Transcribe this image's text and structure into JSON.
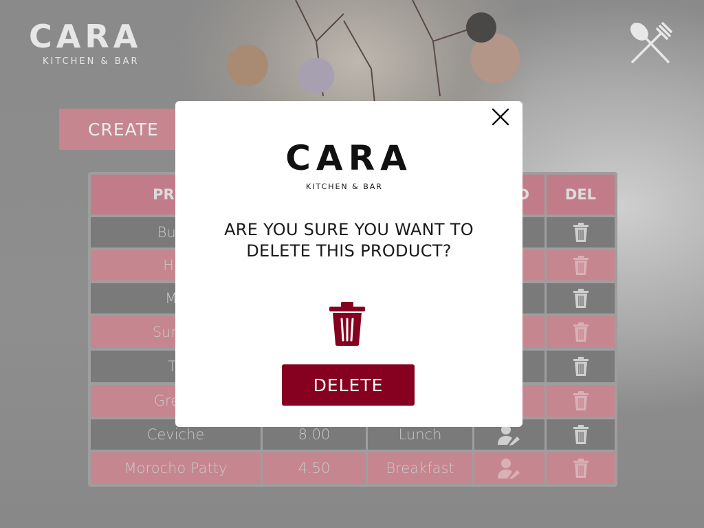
{
  "brand": {
    "name": "CARA",
    "tagline": "KITCHEN & BAR"
  },
  "toolbar": {
    "create_label": "CREATE"
  },
  "table": {
    "headers": [
      "PROD",
      "",
      "",
      "D",
      "DEL"
    ],
    "rows": [
      {
        "name": "Bubb",
        "price": "",
        "category": ""
      },
      {
        "name": "Hot",
        "price": "",
        "category": ""
      },
      {
        "name": "Ma",
        "price": "",
        "category": ""
      },
      {
        "name": "Summ",
        "price": "",
        "category": ""
      },
      {
        "name": "Ta",
        "price": "",
        "category": ""
      },
      {
        "name": "Green",
        "price": "",
        "category": ""
      },
      {
        "name": "Ceviche",
        "price": "8.00",
        "category": "Lunch"
      },
      {
        "name": "Morocho Patty",
        "price": "4.50",
        "category": "Breakfast"
      }
    ]
  },
  "modal": {
    "question": "ARE YOU SURE YOU WANT TO DELETE THIS PRODUCT?",
    "delete_label": "DELETE",
    "close_icon": "close-icon",
    "trash_icon": "trash-icon"
  },
  "colors": {
    "accent": "#86001f",
    "header_bg": "#c27c89",
    "row_dark": "#7a7a7a",
    "row_light": "#c6868f"
  }
}
